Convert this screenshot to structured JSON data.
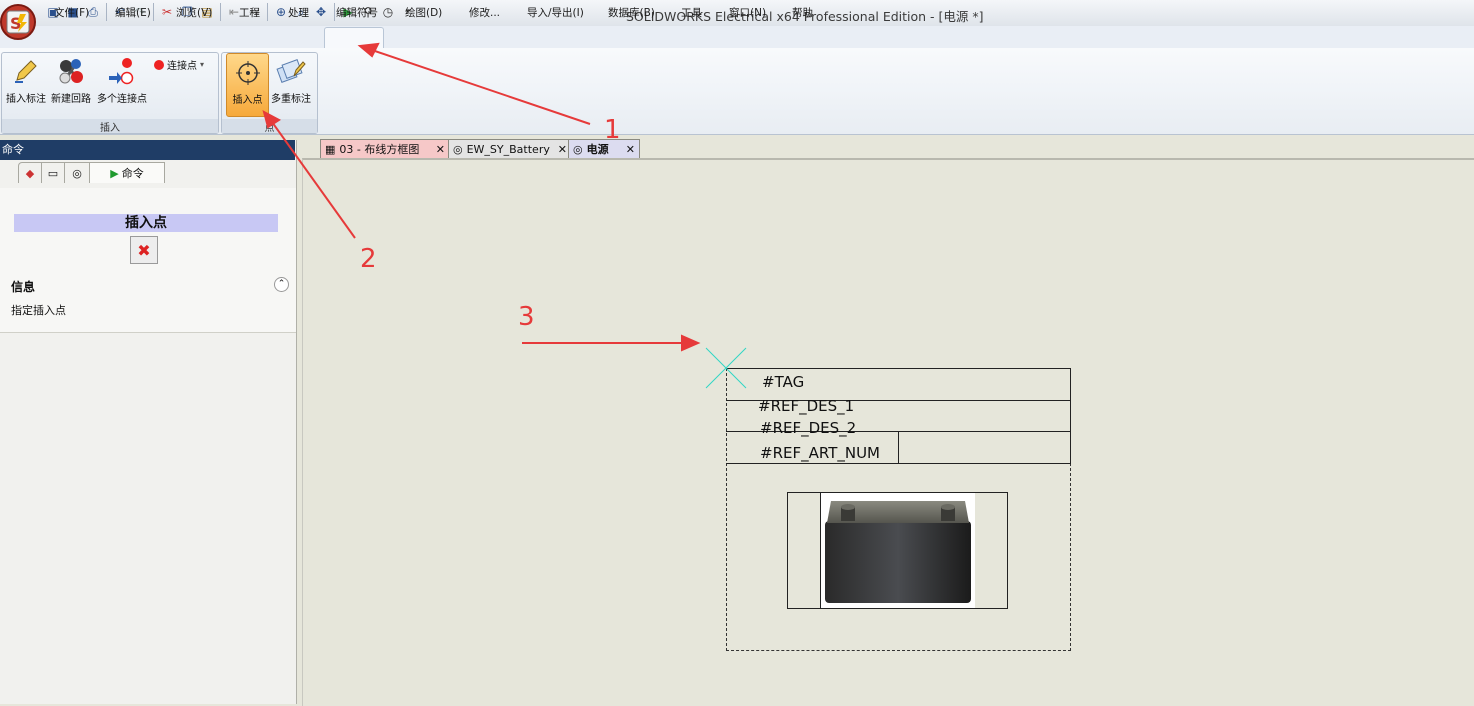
{
  "window": {
    "title": "SOLIDWORKS Electrical x64 Professional Edition - [电源 *]"
  },
  "menu": {
    "items": [
      "文件(F)",
      "编辑(E)",
      "浏览(V)",
      "工程",
      "处理",
      "编辑符号",
      "绘图(D)",
      "修改...",
      "导入/导出(I)",
      "数据库(B)",
      "工具",
      "窗口(N)",
      "帮助"
    ]
  },
  "ribbon": {
    "group_insert": {
      "label": "插入",
      "btn_insert_label": "插入标注",
      "btn_new_circuit": "新建回路",
      "btn_multi_points": "多个连接点",
      "btn_connection_point": "连接点"
    },
    "group_point": {
      "label": "点",
      "btn_insert_point": "插入点",
      "btn_multi_label": "多重标注"
    }
  },
  "panel": {
    "header": "命令",
    "tab_command": "命令",
    "command_title": "插入点",
    "info_label": "信息",
    "info_text": "指定插入点"
  },
  "doc_tabs": [
    {
      "label": "03 - 布线方框图",
      "color": "#f6c8c8"
    },
    {
      "label": "EW_SY_Battery",
      "color": "#e4e4e4"
    },
    {
      "label": "电源",
      "color": "#dcdcf0"
    }
  ],
  "symbol": {
    "tag": "#TAG",
    "ref_des_1": "#REF_DES_1",
    "ref_des_2": "#REF_DES_2",
    "ref_art_num": "#REF_ART_NUM"
  },
  "annotations": {
    "one": "1",
    "two": "2",
    "three": "3"
  },
  "colors": {
    "accent": "#e63a3a",
    "cursor": "#2fd6c4"
  }
}
